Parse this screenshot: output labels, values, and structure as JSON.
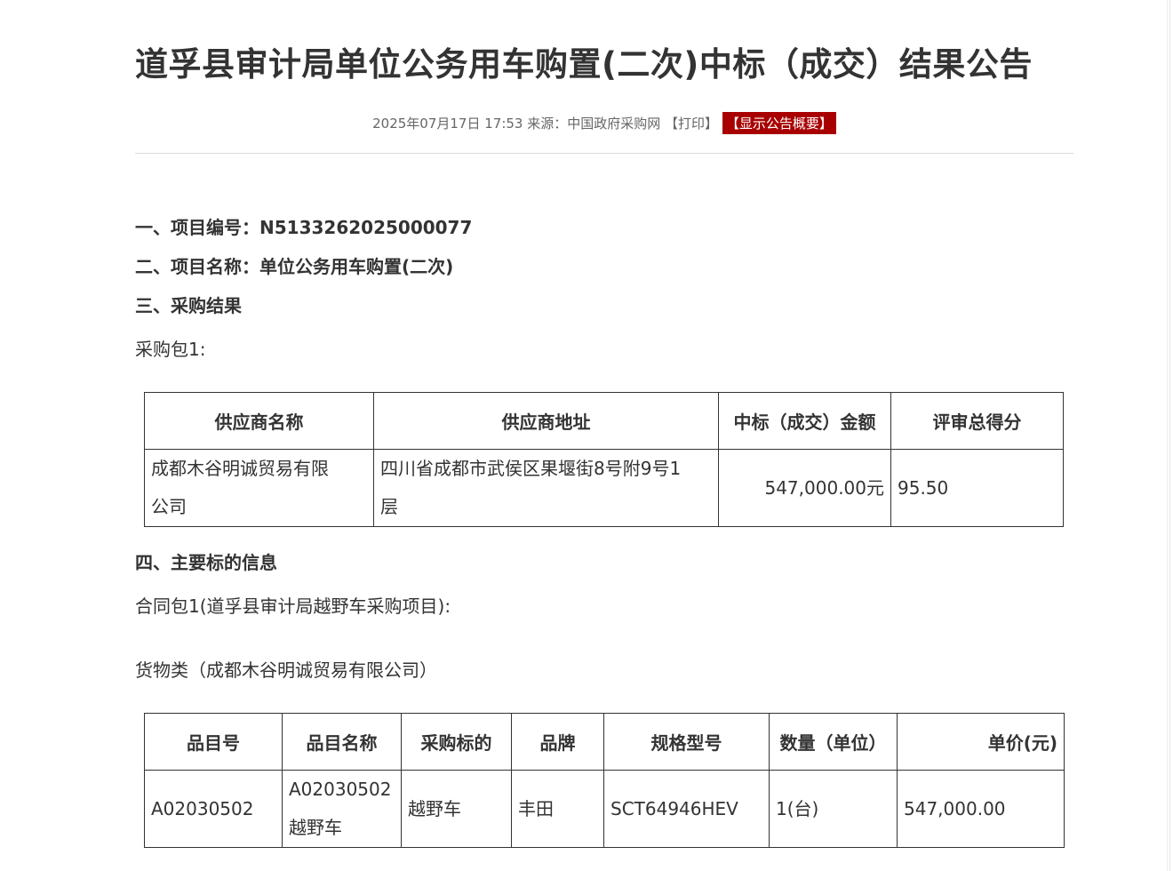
{
  "title": "道孚县审计局单位公务用车购置(二次)中标（成交）结果公告",
  "meta": {
    "datetime": "2025年07月17日 17:53",
    "source": "来源：中国政府采购网",
    "print_label": "【打印】",
    "summary_label": "【显示公告概要】"
  },
  "colors": {
    "accent": "#a80000",
    "text": "#333333",
    "meta": "#666666"
  },
  "sections": {
    "project_no": "一、项目编号：N5133262025000077",
    "project_name": "二、项目名称：单位公务用车购置(二次)",
    "result_heading": "三、采购结果",
    "package_label": "采购包1:",
    "main_info_heading": "四、主要标的信息",
    "contract_label": "合同包1(道孚县审计局越野车采购项目):",
    "goods_label": "货物类（成都木谷明诚贸易有限公司）"
  },
  "result_table": {
    "headers": [
      "供应商名称",
      "供应商地址",
      "中标（成交）金额",
      "评审总得分"
    ],
    "rows": [
      {
        "supplier_line1": "成都木谷明诚贸易有限",
        "supplier_line2": "公司",
        "address_line1": "四川省成都市武侯区果堰街8号附9号1",
        "address_line2": "层",
        "amount": "547,000.00元",
        "score": "95.50"
      }
    ]
  },
  "goods_table": {
    "headers": [
      "品目号",
      "品目名称",
      "采购标的",
      "品牌",
      "规格型号",
      "数量（单位）",
      "单价(元)"
    ],
    "rows": [
      {
        "item_no": "A02030502",
        "item_name_line1": "A02030502",
        "item_name_line2": "越野车",
        "subject": "越野车",
        "brand": "丰田",
        "model": "SCT64946HEV",
        "quantity": "1(台)",
        "unit_price": "547,000.00"
      }
    ]
  }
}
